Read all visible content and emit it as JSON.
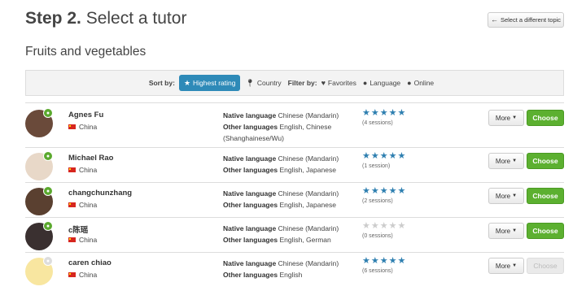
{
  "header": {
    "step_prefix": "Step 2.",
    "step_title": "Select a tutor",
    "change_topic": "Select a different topic"
  },
  "topic": "Fruits and vegetables",
  "filters": {
    "sort_label": "Sort by:",
    "sort_active": "Highest rating",
    "sort_country": "Country",
    "filter_label": "Filter by:",
    "favorites": "Favorites",
    "language": "Language",
    "online": "Online"
  },
  "tutors": [
    {
      "name": "Agnes Fu",
      "country": "China",
      "native_label": "Native language",
      "native": "Chinese (Mandarin)",
      "other_label": "Other languages",
      "other": "English, Chinese (Shanghainese/Wu)",
      "rating": 5,
      "sessions": "(4 sessions)",
      "more": "More",
      "choose": "Choose"
    },
    {
      "name": "Michael Rao",
      "country": "China",
      "native_label": "Native language",
      "native": "Chinese (Mandarin)",
      "other_label": "Other languages",
      "other": "English, Japanese",
      "rating": 5,
      "sessions": "(1 session)",
      "more": "More",
      "choose": "Choose"
    },
    {
      "name": "changchunzhang",
      "country": "China",
      "native_label": "Native language",
      "native": "Chinese (Mandarin)",
      "other_label": "Other languages",
      "other": "English, Japanese",
      "rating": 5,
      "sessions": "(2 sessions)",
      "more": "More",
      "choose": "Choose"
    },
    {
      "name": "c陈瑶",
      "country": "China",
      "native_label": "Native language",
      "native": "Chinese (Mandarin)",
      "other_label": "Other languages",
      "other": "English, German",
      "rating": 0,
      "sessions": "(0 sessions)",
      "more": "More",
      "choose": "Choose"
    },
    {
      "name": "caren chiao",
      "country": "China",
      "native_label": "Native language",
      "native": "Chinese (Mandarin)",
      "other_label": "Other languages",
      "other": "English",
      "rating": 4.5,
      "sessions": "(6 sessions)",
      "more": "More",
      "choose": "Choose"
    }
  ],
  "colors": {
    "accent": "#2e8ab8",
    "choose": "#5cb030",
    "star": "#2e7fb0"
  }
}
